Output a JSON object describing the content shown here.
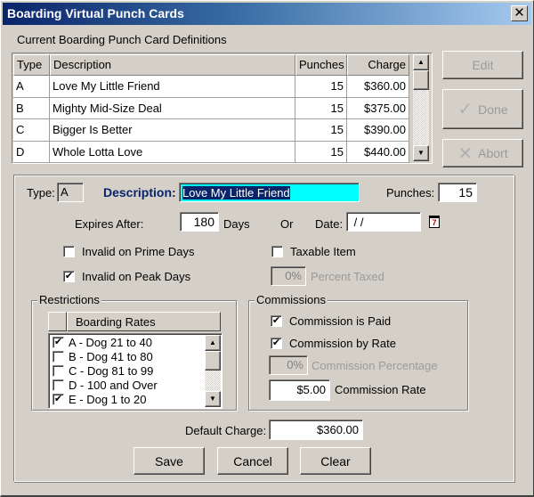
{
  "window": {
    "title": "Boarding Virtual Punch Cards",
    "close_label": "✕"
  },
  "definitions": {
    "label": "Current Boarding Punch Card Definitions",
    "columns": [
      "Type",
      "Description",
      "Punches",
      "Charge"
    ],
    "rows": [
      {
        "type": "A",
        "description": "Love My Little Friend",
        "punches": "15",
        "charge": "$360.00"
      },
      {
        "type": "B",
        "description": "Mighty Mid-Size Deal",
        "punches": "15",
        "charge": "$375.00"
      },
      {
        "type": "C",
        "description": "Bigger Is Better",
        "punches": "15",
        "charge": "$390.00"
      },
      {
        "type": "D",
        "description": "Whole Lotta Love",
        "punches": "15",
        "charge": "$440.00"
      }
    ]
  },
  "side_buttons": {
    "edit": "Edit",
    "done": "Done",
    "abort": "Abort",
    "done_icon": "✓",
    "abort_icon": "✕"
  },
  "form": {
    "type_label": "Type:",
    "type_value": "A",
    "description_label": "Description:",
    "description_value": "Love My Little Friend",
    "description_highlight_color": "#00ffff",
    "punches_label": "Punches:",
    "punches_value": "15",
    "expires_after_label": "Expires After:",
    "expires_after_value": "180",
    "days_label": "Days",
    "or_label": "Or",
    "date_label": "Date:",
    "date_value": " / /",
    "calendar_icon_text": "7",
    "invalid_prime_label": "Invalid on Prime Days",
    "invalid_prime_checked": false,
    "invalid_peak_label": "Invalid on Peak Days",
    "invalid_peak_checked": true,
    "taxable_label": "Taxable Item",
    "taxable_checked": false,
    "percent_taxed_value": "0%",
    "percent_taxed_label": "Percent Taxed"
  },
  "restrictions": {
    "title": "Restrictions",
    "header": "Boarding Rates",
    "items": [
      {
        "label": "A - Dog 21 to 40",
        "checked": true
      },
      {
        "label": "B - Dog 41 to 80",
        "checked": false
      },
      {
        "label": "C - Dog 81 to 99",
        "checked": false
      },
      {
        "label": "D - 100 and Over",
        "checked": false
      },
      {
        "label": "E - Dog 1 to 20",
        "checked": true
      }
    ]
  },
  "commissions": {
    "title": "Commissions",
    "is_paid_label": "Commission is Paid",
    "is_paid_checked": true,
    "by_rate_label": "Commission by Rate",
    "by_rate_checked": true,
    "percentage_value": "0%",
    "percentage_label": "Commission Percentage",
    "rate_value": "$5.00",
    "rate_label": "Commission Rate"
  },
  "footer": {
    "default_charge_label": "Default Charge:",
    "default_charge_value": "$360.00",
    "save": "Save",
    "cancel": "Cancel",
    "clear": "Clear"
  },
  "scroll_arrows": {
    "up": "▲",
    "down": "▼"
  },
  "check_mark": "✔"
}
